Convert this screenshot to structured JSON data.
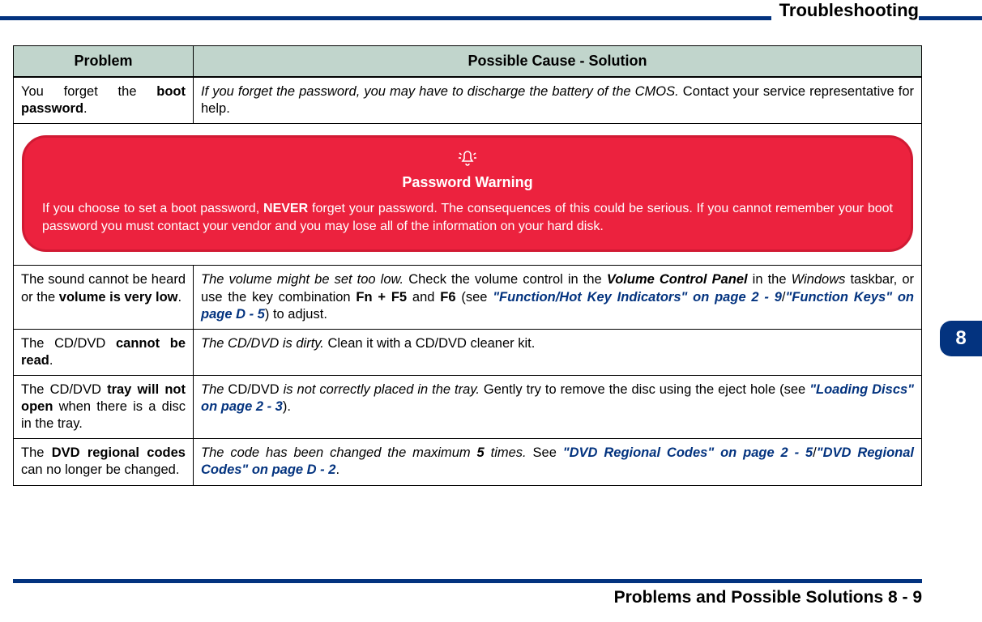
{
  "header": {
    "title": "Troubleshooting"
  },
  "table": {
    "headers": {
      "problem": "Problem",
      "solution": "Possible Cause - Solution"
    },
    "rows": [
      {
        "problem_pre": "You forget the ",
        "problem_bold": "boot password",
        "problem_post": ".",
        "sol_italic": "If you forget the password, you may have to discharge the battery of the CMOS.",
        "sol_rest": " Contact your service representative for help."
      }
    ],
    "warning": {
      "title": "Password Warning",
      "body_pre": "If you choose to set a boot password, ",
      "body_bold": "NEVER",
      "body_post": " forget your password. The consequences of this could be serious. If you cannot remember your boot password you must contact your vendor and you may lose all of the information on your hard disk."
    },
    "rows2": [
      {
        "problem_pre": "The sound cannot be heard or the ",
        "problem_bold": "volume is very low",
        "problem_post": ".",
        "sol_i1": "The volume might be set too low.",
        "sol_t1": " Check the volume control in the ",
        "sol_bi1": "Volume Control Panel",
        "sol_t2": " in the ",
        "sol_i2": "Windows",
        "sol_t3": " taskbar, or use the key combination ",
        "sol_b1": "Fn + F5",
        "sol_t4": " and ",
        "sol_b2": "F6",
        "sol_t5": " (see ",
        "sol_link1": "\"Function/Hot Key Indicators\" on page 2 - 9",
        "sol_t6": "/",
        "sol_link2": "\"Function Keys\" on page D - 5",
        "sol_t7": ") to adjust."
      },
      {
        "problem_pre": "The CD/DVD ",
        "problem_bold": "cannot be read",
        "problem_post": ".",
        "sol_i1": "The CD/DVD is dirty.",
        "sol_t1": " Clean it with a CD/DVD cleaner kit."
      },
      {
        "problem_pre": "The CD/DVD ",
        "problem_bold": "tray will not open",
        "problem_post": " when there is a disc in the tray.",
        "sol_i0": "The ",
        "sol_t0": "CD/DVD ",
        "sol_i1": "is not correctly placed in the tray.",
        "sol_t1": " Gently try to remove the disc using the eject hole (see ",
        "sol_link1": "\"Loading Discs\" on page 2 - 3",
        "sol_t2": ")."
      },
      {
        "problem_pre": "The ",
        "problem_bold": "DVD regional codes",
        "problem_post": " can no longer be changed.",
        "sol_i1": "The code has been changed the maximum ",
        "sol_b1": "5",
        "sol_i2": " times.",
        "sol_t1": " See ",
        "sol_link1": "\"DVD Regional Codes\" on page 2 - 5",
        "sol_t2": "/",
        "sol_link2": "\"DVD Regional Codes\" on page D - 2",
        "sol_t3": "."
      }
    ]
  },
  "sideTab": "8",
  "footer": "Problems and Possible Solutions  8  -  9"
}
